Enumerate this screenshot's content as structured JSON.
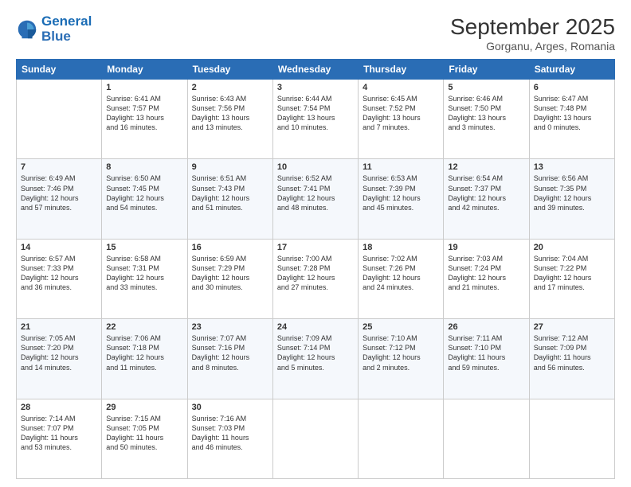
{
  "header": {
    "logo_line1": "General",
    "logo_line2": "Blue",
    "month": "September 2025",
    "location": "Gorganu, Arges, Romania"
  },
  "weekdays": [
    "Sunday",
    "Monday",
    "Tuesday",
    "Wednesday",
    "Thursday",
    "Friday",
    "Saturday"
  ],
  "weeks": [
    [
      {
        "day": "",
        "info": ""
      },
      {
        "day": "1",
        "info": "Sunrise: 6:41 AM\nSunset: 7:57 PM\nDaylight: 13 hours\nand 16 minutes."
      },
      {
        "day": "2",
        "info": "Sunrise: 6:43 AM\nSunset: 7:56 PM\nDaylight: 13 hours\nand 13 minutes."
      },
      {
        "day": "3",
        "info": "Sunrise: 6:44 AM\nSunset: 7:54 PM\nDaylight: 13 hours\nand 10 minutes."
      },
      {
        "day": "4",
        "info": "Sunrise: 6:45 AM\nSunset: 7:52 PM\nDaylight: 13 hours\nand 7 minutes."
      },
      {
        "day": "5",
        "info": "Sunrise: 6:46 AM\nSunset: 7:50 PM\nDaylight: 13 hours\nand 3 minutes."
      },
      {
        "day": "6",
        "info": "Sunrise: 6:47 AM\nSunset: 7:48 PM\nDaylight: 13 hours\nand 0 minutes."
      }
    ],
    [
      {
        "day": "7",
        "info": "Sunrise: 6:49 AM\nSunset: 7:46 PM\nDaylight: 12 hours\nand 57 minutes."
      },
      {
        "day": "8",
        "info": "Sunrise: 6:50 AM\nSunset: 7:45 PM\nDaylight: 12 hours\nand 54 minutes."
      },
      {
        "day": "9",
        "info": "Sunrise: 6:51 AM\nSunset: 7:43 PM\nDaylight: 12 hours\nand 51 minutes."
      },
      {
        "day": "10",
        "info": "Sunrise: 6:52 AM\nSunset: 7:41 PM\nDaylight: 12 hours\nand 48 minutes."
      },
      {
        "day": "11",
        "info": "Sunrise: 6:53 AM\nSunset: 7:39 PM\nDaylight: 12 hours\nand 45 minutes."
      },
      {
        "day": "12",
        "info": "Sunrise: 6:54 AM\nSunset: 7:37 PM\nDaylight: 12 hours\nand 42 minutes."
      },
      {
        "day": "13",
        "info": "Sunrise: 6:56 AM\nSunset: 7:35 PM\nDaylight: 12 hours\nand 39 minutes."
      }
    ],
    [
      {
        "day": "14",
        "info": "Sunrise: 6:57 AM\nSunset: 7:33 PM\nDaylight: 12 hours\nand 36 minutes."
      },
      {
        "day": "15",
        "info": "Sunrise: 6:58 AM\nSunset: 7:31 PM\nDaylight: 12 hours\nand 33 minutes."
      },
      {
        "day": "16",
        "info": "Sunrise: 6:59 AM\nSunset: 7:29 PM\nDaylight: 12 hours\nand 30 minutes."
      },
      {
        "day": "17",
        "info": "Sunrise: 7:00 AM\nSunset: 7:28 PM\nDaylight: 12 hours\nand 27 minutes."
      },
      {
        "day": "18",
        "info": "Sunrise: 7:02 AM\nSunset: 7:26 PM\nDaylight: 12 hours\nand 24 minutes."
      },
      {
        "day": "19",
        "info": "Sunrise: 7:03 AM\nSunset: 7:24 PM\nDaylight: 12 hours\nand 21 minutes."
      },
      {
        "day": "20",
        "info": "Sunrise: 7:04 AM\nSunset: 7:22 PM\nDaylight: 12 hours\nand 17 minutes."
      }
    ],
    [
      {
        "day": "21",
        "info": "Sunrise: 7:05 AM\nSunset: 7:20 PM\nDaylight: 12 hours\nand 14 minutes."
      },
      {
        "day": "22",
        "info": "Sunrise: 7:06 AM\nSunset: 7:18 PM\nDaylight: 12 hours\nand 11 minutes."
      },
      {
        "day": "23",
        "info": "Sunrise: 7:07 AM\nSunset: 7:16 PM\nDaylight: 12 hours\nand 8 minutes."
      },
      {
        "day": "24",
        "info": "Sunrise: 7:09 AM\nSunset: 7:14 PM\nDaylight: 12 hours\nand 5 minutes."
      },
      {
        "day": "25",
        "info": "Sunrise: 7:10 AM\nSunset: 7:12 PM\nDaylight: 12 hours\nand 2 minutes."
      },
      {
        "day": "26",
        "info": "Sunrise: 7:11 AM\nSunset: 7:10 PM\nDaylight: 11 hours\nand 59 minutes."
      },
      {
        "day": "27",
        "info": "Sunrise: 7:12 AM\nSunset: 7:09 PM\nDaylight: 11 hours\nand 56 minutes."
      }
    ],
    [
      {
        "day": "28",
        "info": "Sunrise: 7:14 AM\nSunset: 7:07 PM\nDaylight: 11 hours\nand 53 minutes."
      },
      {
        "day": "29",
        "info": "Sunrise: 7:15 AM\nSunset: 7:05 PM\nDaylight: 11 hours\nand 50 minutes."
      },
      {
        "day": "30",
        "info": "Sunrise: 7:16 AM\nSunset: 7:03 PM\nDaylight: 11 hours\nand 46 minutes."
      },
      {
        "day": "",
        "info": ""
      },
      {
        "day": "",
        "info": ""
      },
      {
        "day": "",
        "info": ""
      },
      {
        "day": "",
        "info": ""
      }
    ]
  ]
}
